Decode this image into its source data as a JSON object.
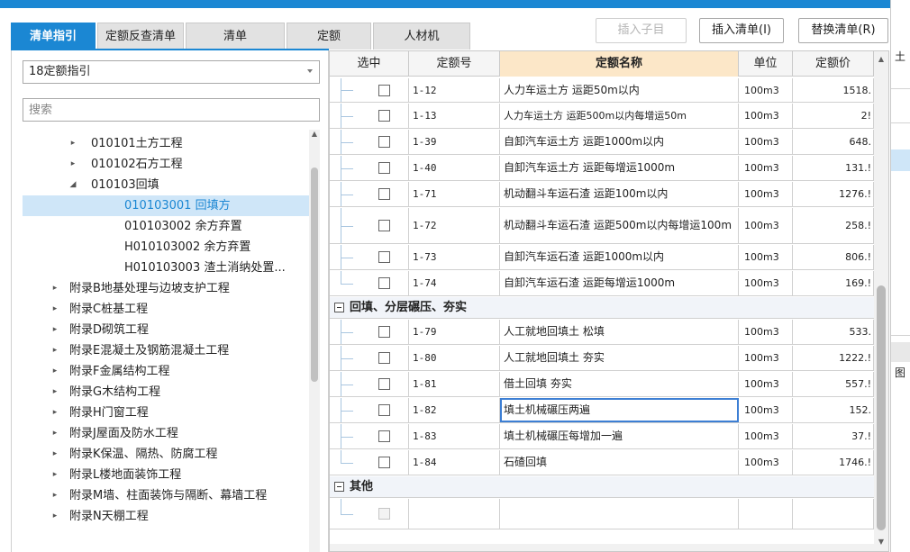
{
  "tabs": [
    {
      "label": "清单指引",
      "active": true
    },
    {
      "label": "定额反查清单",
      "active": false
    },
    {
      "label": "清单",
      "active": false
    },
    {
      "label": "定额",
      "active": false
    },
    {
      "label": "人材机",
      "active": false
    }
  ],
  "toolbar": {
    "insert_child": "插入子目",
    "insert_list": "插入清单(I)",
    "replace_list": "替换清单(R)"
  },
  "guide_select": {
    "value": "18定额指引"
  },
  "search": {
    "placeholder": "搜索"
  },
  "tree": [
    {
      "label": "010101土方工程",
      "arrow": "▸",
      "selected": false
    },
    {
      "label": "010102石方工程",
      "arrow": "▸",
      "selected": false
    },
    {
      "label": "010103回填",
      "arrow": "◢",
      "selected": false
    },
    {
      "label": "010103001  回填方",
      "arrow": "",
      "selected": true
    },
    {
      "label": "010103002  余方弃置",
      "arrow": "",
      "selected": false
    },
    {
      "label": "H010103002  余方弃置",
      "arrow": "",
      "selected": false
    },
    {
      "label": "H010103003  渣土消纳处置...",
      "arrow": "",
      "selected": false
    },
    {
      "label": "附录B地基处理与边坡支护工程",
      "arrow": "▸",
      "selected": false
    },
    {
      "label": "附录C桩基工程",
      "arrow": "▸",
      "selected": false
    },
    {
      "label": "附录D砌筑工程",
      "arrow": "▸",
      "selected": false
    },
    {
      "label": "附录E混凝土及钢筋混凝土工程",
      "arrow": "▸",
      "selected": false
    },
    {
      "label": "附录F金属结构工程",
      "arrow": "▸",
      "selected": false
    },
    {
      "label": "附录G木结构工程",
      "arrow": "▸",
      "selected": false
    },
    {
      "label": "附录H门窗工程",
      "arrow": "▸",
      "selected": false
    },
    {
      "label": "附录J屋面及防水工程",
      "arrow": "▸",
      "selected": false
    },
    {
      "label": "附录K保温、隔热、防腐工程",
      "arrow": "▸",
      "selected": false
    },
    {
      "label": "附录L楼地面装饰工程",
      "arrow": "▸",
      "selected": false
    },
    {
      "label": "附录M墙、柱面装饰与隔断、幕墙工程",
      "arrow": "▸",
      "selected": false
    },
    {
      "label": "附录N天棚工程",
      "arrow": "▸",
      "selected": false
    }
  ],
  "grid": {
    "columns": {
      "select": "选中",
      "code": "定额号",
      "name": "定额名称",
      "unit": "单位",
      "price": "定额价"
    },
    "rows_a": [
      {
        "code": "1-12",
        "name": "人力车运土方 运距50m以内",
        "unit": "100m3",
        "price": "1518."
      },
      {
        "code": "1-13",
        "name": "人力车运土方 运距500m以内每增运50m",
        "unit": "100m3",
        "price": "2!"
      },
      {
        "code": "1-39",
        "name": "自卸汽车运土方 运距1000m以内",
        "unit": "100m3",
        "price": "648."
      },
      {
        "code": "1-40",
        "name": "自卸汽车运土方 运距每增运1000m",
        "unit": "100m3",
        "price": "131.!"
      },
      {
        "code": "1-71",
        "name": "机动翻斗车运石渣 运距100m以内",
        "unit": "100m3",
        "price": "1276.!"
      },
      {
        "code": "1-72",
        "name": "机动翻斗车运石渣 运距500m以内每增运100m",
        "unit": "100m3",
        "price": "258.!"
      },
      {
        "code": "1-73",
        "name": "自卸汽车运石渣 运距1000m以内",
        "unit": "100m3",
        "price": "806.!"
      },
      {
        "code": "1-74",
        "name": "自卸汽车运石渣 运距每增运1000m",
        "unit": "100m3",
        "price": "169.!"
      }
    ],
    "group_b": "回填、分层碾压、夯实",
    "rows_b": [
      {
        "code": "1-79",
        "name": "人工就地回填土 松填",
        "unit": "100m3",
        "price": "533."
      },
      {
        "code": "1-80",
        "name": "人工就地回填土 夯实",
        "unit": "100m3",
        "price": "1222.!"
      },
      {
        "code": "1-81",
        "name": "借土回填 夯实",
        "unit": "100m3",
        "price": "557.!"
      },
      {
        "code": "1-82",
        "name": "填土机械碾压两遍",
        "unit": "100m3",
        "price": "152."
      },
      {
        "code": "1-83",
        "name": "填土机械碾压每增加一遍",
        "unit": "100m3",
        "price": "37.!"
      },
      {
        "code": "1-84",
        "name": "石碴回填",
        "unit": "100m3",
        "price": "1746.!"
      }
    ],
    "group_c": "其他"
  },
  "right_panel": {
    "text_a": "土",
    "text_b": "图"
  }
}
